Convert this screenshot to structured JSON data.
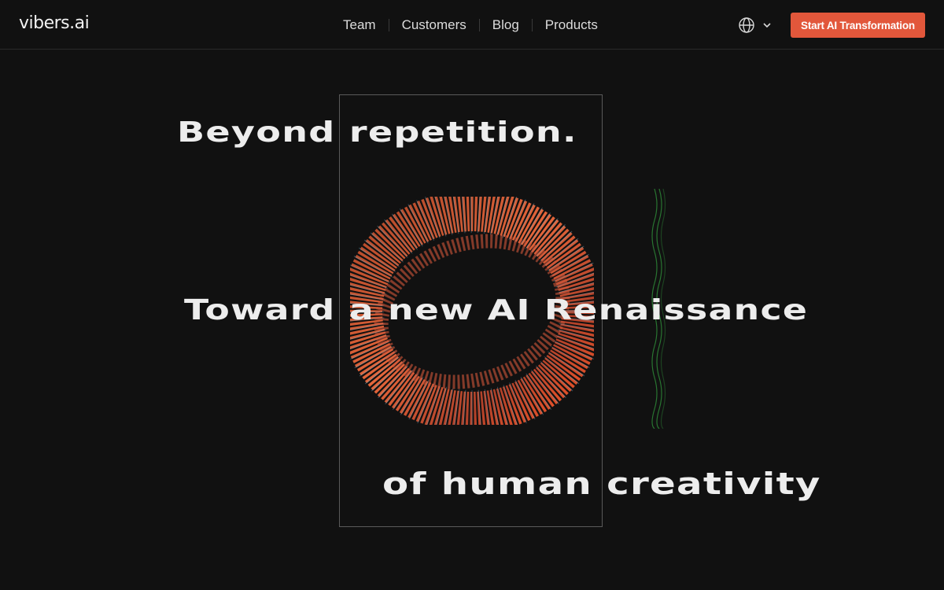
{
  "brand": {
    "logo": "vibers.ai"
  },
  "nav": {
    "links": [
      {
        "label": "Team"
      },
      {
        "label": "Customers"
      },
      {
        "label": "Blog"
      },
      {
        "label": "Products"
      }
    ],
    "language_icon": "globe-icon",
    "dropdown_icon": "chevron-down-icon",
    "cta_label": "Start AI Transformation"
  },
  "hero": {
    "line1": "Beyond repetition.",
    "line2": "Toward a new AI Renaissance",
    "line3": "of human creativity"
  },
  "colors": {
    "background": "#111111",
    "accent": "#e2573b",
    "text": "#ededed",
    "art_orange": "#e8552e",
    "art_green": "#2f8f3a"
  }
}
